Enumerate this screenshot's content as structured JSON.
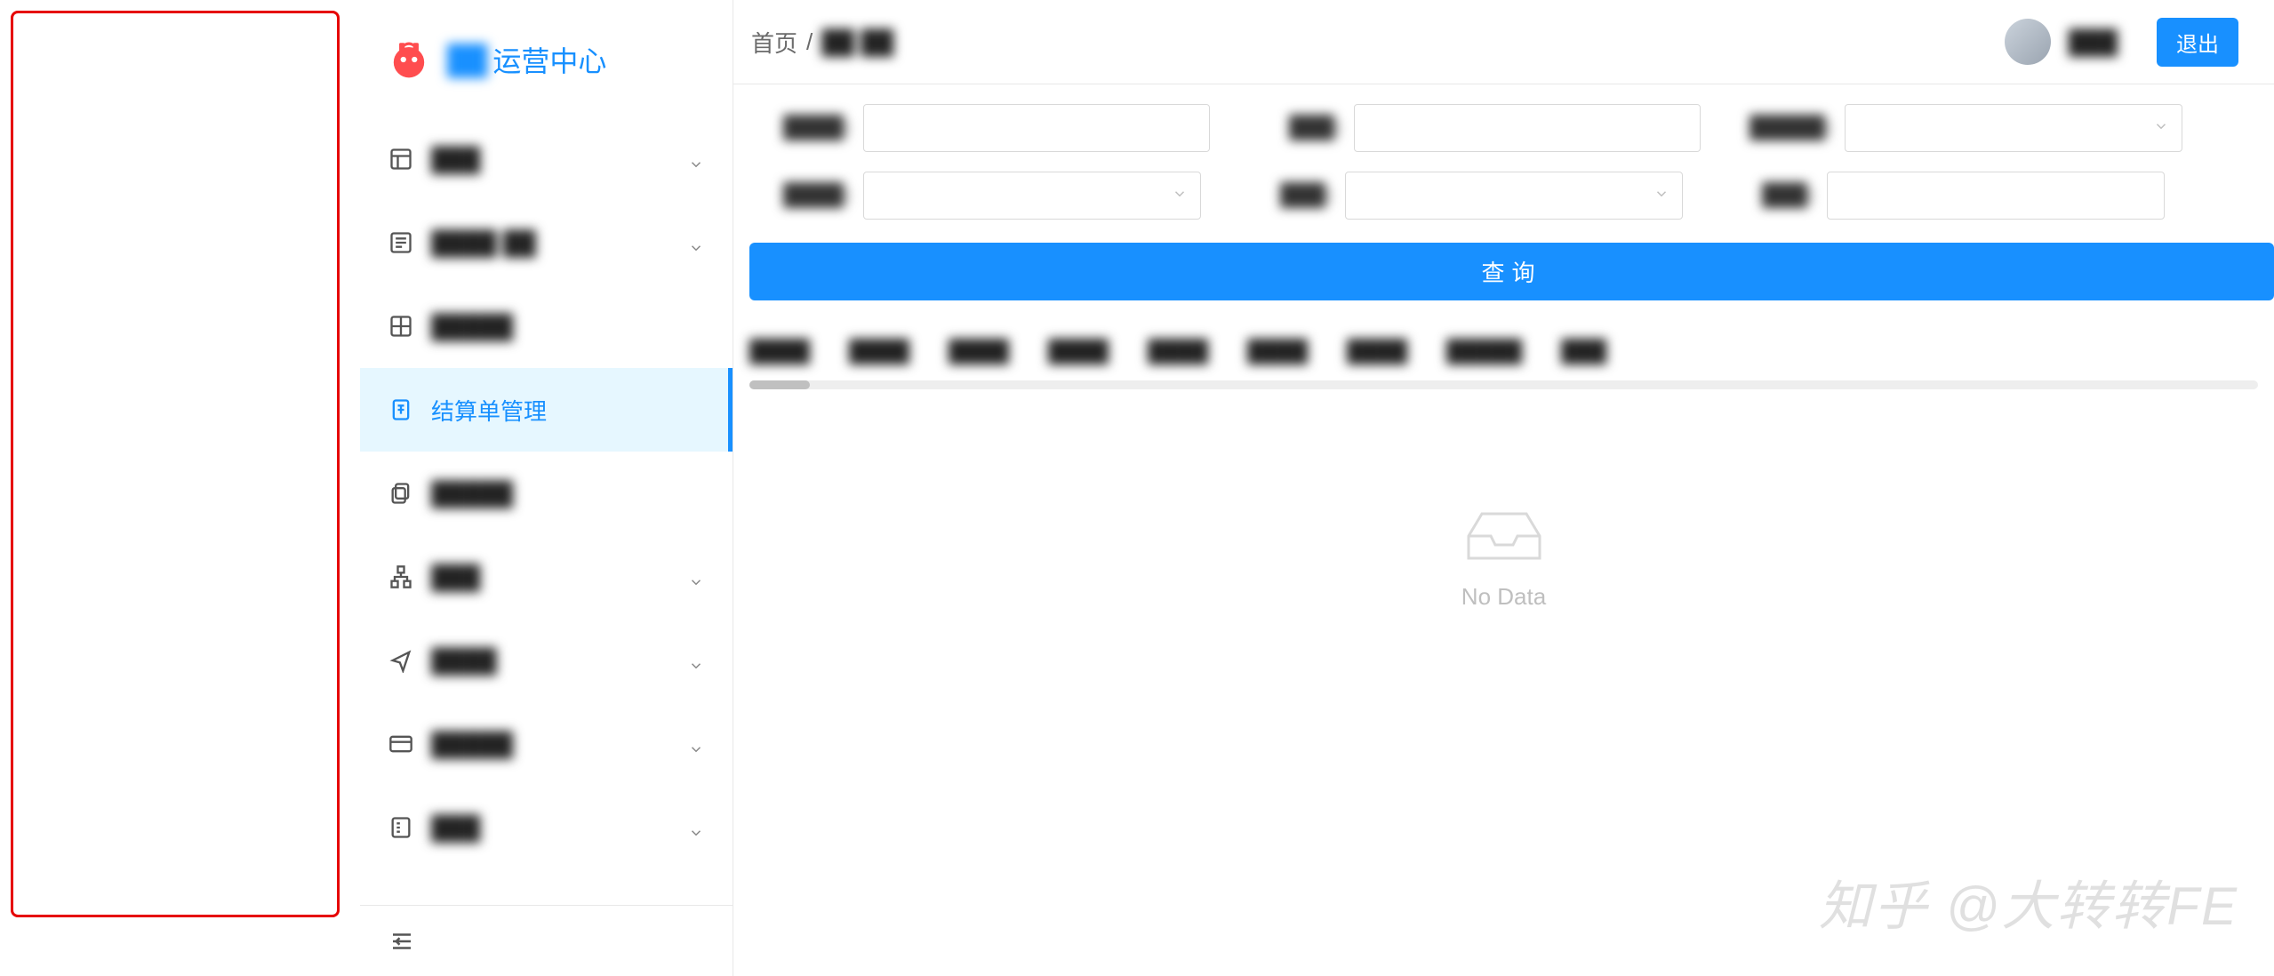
{
  "brand": {
    "title_suffix": "运营中心",
    "title_prefix_blur": "██"
  },
  "sidebar": {
    "items": [
      {
        "label_blur": "███",
        "has_children": true
      },
      {
        "label_blur": "████ ██",
        "has_children": true
      },
      {
        "label_blur": "█████",
        "has_children": false
      },
      {
        "label": "结算单管理",
        "active": true,
        "has_children": false
      },
      {
        "label_blur": "█████",
        "has_children": false
      },
      {
        "label_blur": "███",
        "has_children": true
      },
      {
        "label_blur": "████",
        "has_children": true
      },
      {
        "label_blur": "█████",
        "has_children": true
      },
      {
        "label_blur": "███",
        "has_children": true
      }
    ]
  },
  "header": {
    "breadcrumb_home": "首页",
    "breadcrumb_sep": "/",
    "breadcrumb_current_blur": "██ ██",
    "username_blur": "███",
    "logout": "退出"
  },
  "filters": {
    "row1": [
      {
        "label_blur": "████:",
        "type": "input",
        "width": "w380"
      },
      {
        "label_blur": "███:",
        "type": "input",
        "width": "w380"
      },
      {
        "label_blur": "█████:",
        "type": "select",
        "width": "w370"
      }
    ],
    "row2": [
      {
        "label_blur": "████:",
        "type": "select",
        "width": "w370"
      },
      {
        "label_blur": "███:",
        "type": "select",
        "width": "w370"
      },
      {
        "label_blur": "███:",
        "type": "input",
        "width": "w370"
      }
    ],
    "query_button": "查询"
  },
  "table": {
    "columns_blur": [
      "████",
      "████",
      "████",
      "████",
      "████",
      "████",
      "████",
      "█████",
      "███"
    ],
    "empty_text": "No Data"
  },
  "watermark": "知乎 @大转转FE"
}
